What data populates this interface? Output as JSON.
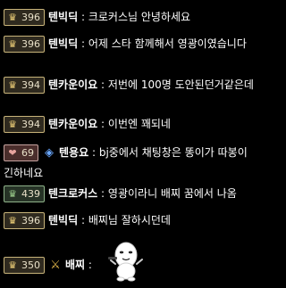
{
  "messages": [
    {
      "badge_icon": "crown-icon",
      "badge_icon_glyph": "♛",
      "badge_level": "396",
      "badge_color": "gold",
      "nickname": "텐빅딕",
      "separator": ":",
      "text": "크로커스님 안녕하세요"
    },
    {
      "badge_icon": "crown-icon",
      "badge_icon_glyph": "♛",
      "badge_level": "396",
      "badge_color": "gold",
      "nickname": "텐빅딕",
      "separator": ":",
      "text": "어제 스타 함께해서 영광이였습니다"
    },
    {
      "badge_icon": "crown-icon",
      "badge_icon_glyph": "♛",
      "badge_level": "394",
      "badge_color": "gold",
      "nickname": "텐카운이요",
      "separator": ":",
      "text": "저번에 100명 도안된던거같은데"
    },
    {
      "badge_icon": "crown-icon",
      "badge_icon_glyph": "♛",
      "badge_level": "394",
      "badge_color": "gold",
      "nickname": "텐카운이요",
      "separator": ":",
      "text": "이번엔 꽤되네"
    },
    {
      "badge_icon": "heart-icon",
      "badge_icon_glyph": "❤",
      "badge_level": "69",
      "badge_color": "red",
      "extra_icon": "diamond-icon",
      "extra_icon_glyph": "◈",
      "nickname": "텐용요",
      "separator": ":",
      "text": "bj중에서 채팅창은 똥이가 따봉이긴하네요"
    },
    {
      "badge_icon": "crown-icon",
      "badge_icon_glyph": "♛",
      "badge_level": "439",
      "badge_color": "green",
      "nickname": "텐크로커스",
      "separator": ":",
      "text": "영광이라니 배찌 꿈에서 나옴"
    },
    {
      "badge_icon": "crown-icon",
      "badge_icon_glyph": "♛",
      "badge_level": "396",
      "badge_color": "gold",
      "nickname": "텐빅딕",
      "separator": ":",
      "text": "배찌님 잘하시던데"
    },
    {
      "badge_icon": "crown-icon",
      "badge_icon_glyph": "♛",
      "badge_level": "350",
      "badge_color": "gold",
      "extra_icon": "sword-icon",
      "extra_icon_glyph": "⚔",
      "nickname": "배찌",
      "separator": ":",
      "text": ""
    }
  ],
  "sticker": {
    "icon": "playful-character-sticker"
  }
}
